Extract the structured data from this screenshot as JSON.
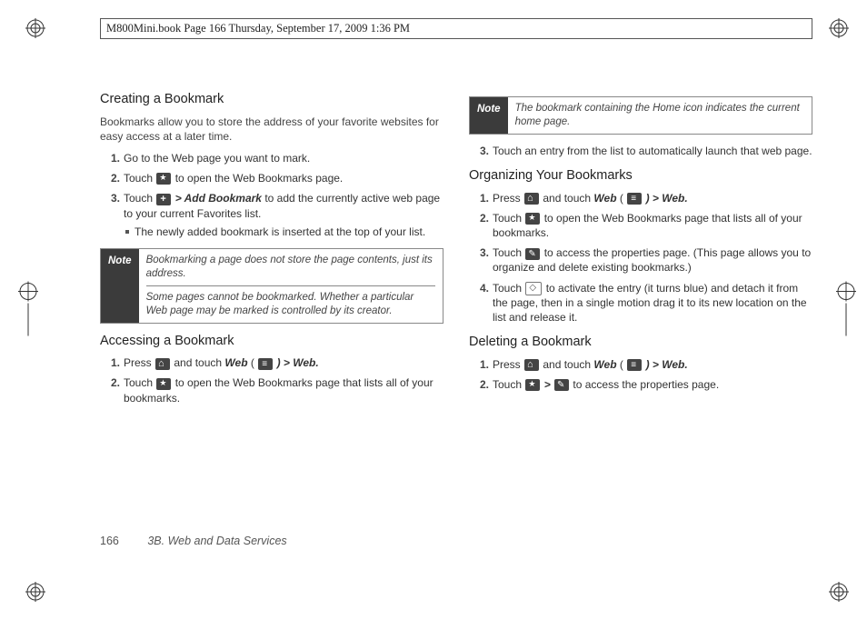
{
  "print_header": "M800Mini.book  Page 166  Thursday, September 17, 2009  1:36 PM",
  "left": {
    "h_a": "Creating a Bookmark",
    "p1": "Bookmarks allow you to store the address of your favorite websites for easy access at a later time.",
    "s1": "Go to the Web page you want to mark.",
    "s2a": "Touch ",
    "s2b": " to open the Web Bookmarks page.",
    "s3a": "Touch ",
    "s3b": " > ",
    "s3c": "Add Bookmark",
    "s3d": " to add the currently active web page to your current Favorites list.",
    "s3_sub": "The newly added bookmark is inserted at the top of your list.",
    "note_label": "Note",
    "note_a1": "Bookmarking a page does not store the page contents, just its address.",
    "note_a2": "Some pages cannot be bookmarked. Whether a particular Web page may be marked is controlled by its creator.",
    "h_b": "Accessing a Bookmark",
    "b1a": "Press ",
    "b1b": " and touch ",
    "b1c": "Web",
    "b1d": " ( ",
    "b1e": " ) > ",
    "b1f": "Web.",
    "b2a": "Touch ",
    "b2b": " to open the Web Bookmarks page that lists all of your bookmarks."
  },
  "right": {
    "note_label": "Note",
    "note_b": "The bookmark containing the Home icon indicates the current home page.",
    "c3": "Touch an entry from the list to automatically launch that web page.",
    "h_c": "Organizing Your Bookmarks",
    "o1a": "Press ",
    "o1b": " and touch ",
    "o1c": "Web",
    "o1d": " ( ",
    "o1e": " ) > ",
    "o1f": "Web.",
    "o2a": "Touch ",
    "o2b": " to open the Web Bookmarks page that lists all of your bookmarks.",
    "o3a": "Touch ",
    "o3b": " to access the properties page. (This page allows you to organize and delete existing bookmarks.)",
    "o4a": "Touch ",
    "o4b": " to activate the entry (it turns blue) and detach it from the page, then in a single motion drag it to its new location on the list and release it.",
    "h_d": "Deleting a Bookmark",
    "d1a": "Press ",
    "d1b": " and touch ",
    "d1c": "Web",
    "d1d": " ( ",
    "d1e": " ) > ",
    "d1f": "Web.",
    "d2a": "Touch ",
    "d2b": " > ",
    "d2c": " to access the properties page."
  },
  "footer": {
    "pageno": "166",
    "section": "3B. Web and Data Services"
  }
}
